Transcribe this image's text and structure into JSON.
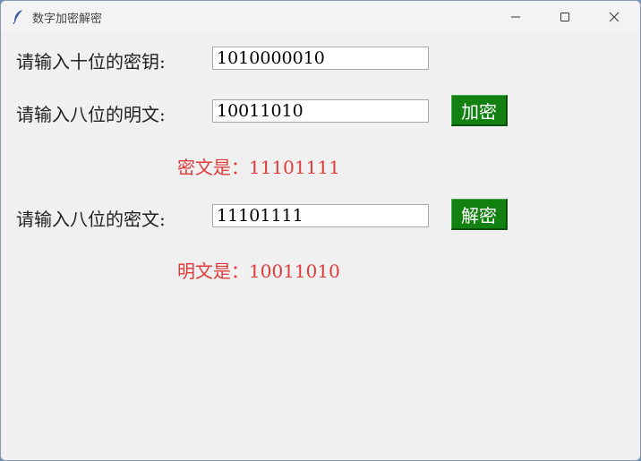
{
  "window": {
    "title": "数字加密解密",
    "icon": "feather-icon",
    "controls": [
      "minimize-icon",
      "maximize-icon",
      "close-icon"
    ]
  },
  "form": {
    "key_label": "请输入十位的密钥:",
    "key_value": "1010000010",
    "plain_label": "请输入八位的明文:",
    "plain_value": "10011010",
    "encrypt_button": "加密",
    "cipher_result": "密文是：11101111",
    "cipher_label": "请输入八位的密文:",
    "cipher_value": "11101111",
    "decrypt_button": "解密",
    "plain_result": "明文是：10011010"
  },
  "colors": {
    "button_bg": "#138012",
    "result_text": "#e03a3a",
    "window_bg": "#f0f0f0"
  }
}
